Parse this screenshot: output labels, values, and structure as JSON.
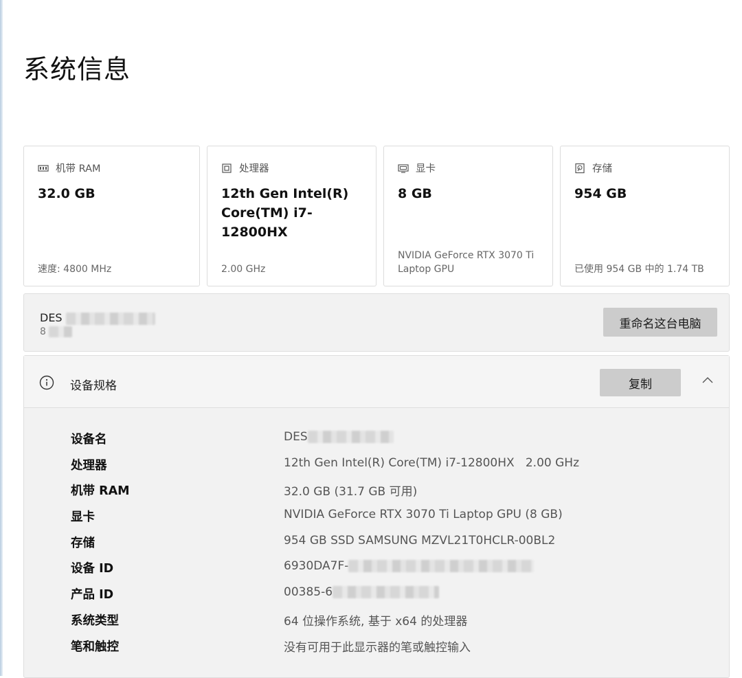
{
  "page": {
    "title": "系统信息"
  },
  "cards": {
    "ram": {
      "label": "机带 RAM",
      "value": "32.0 GB",
      "sub": "速度: 4800 MHz",
      "icon": "memory-icon"
    },
    "cpu": {
      "label": "处理器",
      "value": "12th Gen Intel(R) Core(TM) i7-12800HX",
      "sub": "2.00 GHz",
      "icon": "processor-icon"
    },
    "gpu": {
      "label": "显卡",
      "value": "8 GB",
      "sub": "NVIDIA GeForce RTX 3070 Ti Laptop GPU",
      "icon": "display-adapter-icon"
    },
    "storage": {
      "label": "存储",
      "value": "954 GB",
      "sub": "已使用 954 GB 中的 1.74 TB",
      "icon": "storage-icon"
    }
  },
  "device": {
    "name_visible": "DES",
    "code_visible": "8",
    "rename_label": "重命名这台电脑"
  },
  "specs": {
    "title": "设备规格",
    "copy_label": "复制",
    "rows": [
      {
        "label": "设备名",
        "value": "DES"
      },
      {
        "label": "处理器",
        "value": "12th Gen Intel(R) Core(TM) i7-12800HX   2.00 GHz"
      },
      {
        "label": "机带 RAM",
        "value": "32.0 GB (31.7 GB 可用)"
      },
      {
        "label": "显卡",
        "value": "NVIDIA GeForce RTX 3070 Ti Laptop GPU (8 GB)"
      },
      {
        "label": "存储",
        "value": "954 GB SSD SAMSUNG MZVL21T0HCLR-00BL2"
      },
      {
        "label": "设备 ID",
        "value": "6930DA7F-"
      },
      {
        "label": "产品 ID",
        "value": "00385-6"
      },
      {
        "label": "系统类型",
        "value": "64 位操作系统, 基于 x64 的处理器"
      },
      {
        "label": "笔和触控",
        "value": "没有可用于此显示器的笔或触控输入"
      }
    ]
  },
  "colors": {
    "button_bg": "#cccccc",
    "panel_bg": "#f2f2f2",
    "card_border": "#dcdcdc"
  }
}
